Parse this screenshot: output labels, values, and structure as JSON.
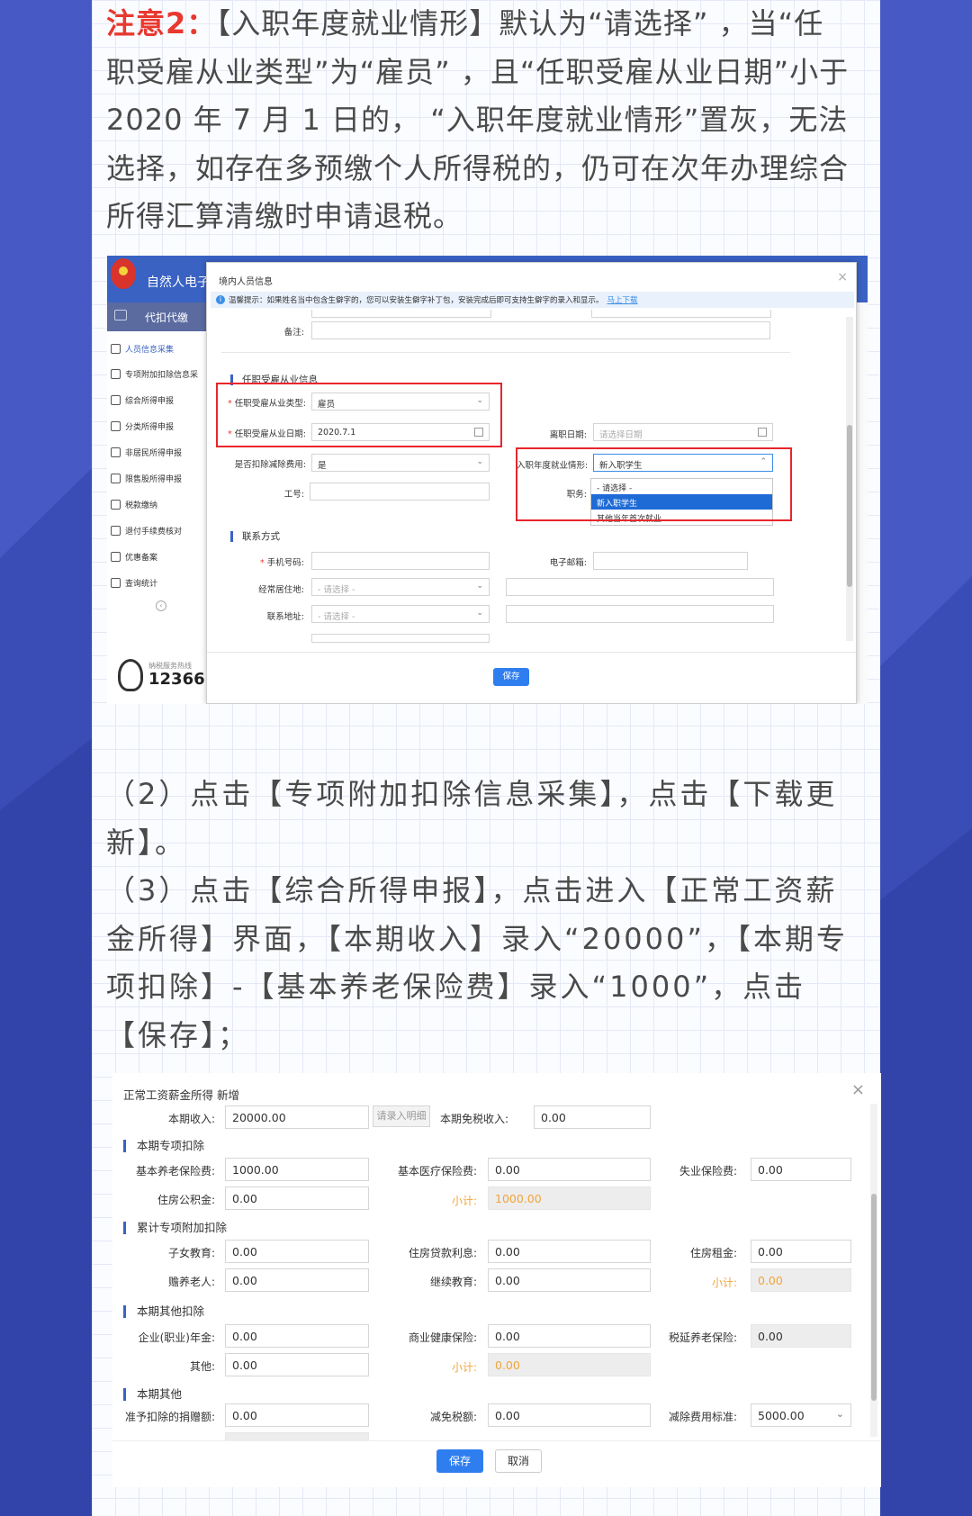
{
  "note2": {
    "prefix": "注意2：",
    "text": "【入职年度就业情形】默认为“请选择” ，当“任职受雇从业类型”为“雇员” ，且“任职受雇从业日期”小于 2020 年 7 月 1 日的， “入职年度就业情形”置灰，无法选择，如存在多预缴个人所得税的，仍可在次年办理综合所得汇算清缴时申请退税。"
  },
  "screenshot1": {
    "brand": "自然人电子",
    "sidebar": {
      "header": "代扣代缴",
      "items": [
        "人员信息采集",
        "专项附加扣除信息采",
        "综合所得申报",
        "分类所得申报",
        "非居民所得申报",
        "限售股所得申报",
        "税款缴纳",
        "退付手续费核对",
        "优惠备案",
        "查询统计"
      ],
      "collapse_glyph": "‹",
      "hotline_label": "纳税服务热线",
      "hotline": "12366"
    },
    "modal": {
      "title": "境内人员信息",
      "close": "×",
      "tip": "温馨提示：如果姓名当中包含生僻字的，您可以安装生僻字补丁包，安装完成后即可支持生僻字的录入和显示。",
      "tip_link": "马上下载",
      "remark_label": "备注:",
      "section_employment": "任职受雇从业信息",
      "type_label": "任职受雇从业类型:",
      "type_value": "雇员",
      "date_label": "任职受雇从业日期:",
      "date_value": "2020.7.1",
      "leave_label": "离职日期:",
      "leave_placeholder": "请选择日期",
      "deduct_label": "是否扣除减除费用:",
      "deduct_value": "是",
      "situation_label": "入职年度就业情形:",
      "situation_value": "新入职学生",
      "situation_options": [
        "- 请选择 -",
        "新入职学生",
        "其他当年首次就业"
      ],
      "jobno_label": "工号:",
      "position_label": "职务:",
      "section_contact": "联系方式",
      "phone_label": "手机号码:",
      "email_label": "电子邮箱:",
      "residence_label": "经常居住地:",
      "residence_placeholder": "- 请选择 -",
      "address_label": "联系地址:",
      "address_placeholder": "- 请选择 -",
      "save": "保存"
    }
  },
  "para2": {
    "step2": "（2）点击【专项附加扣除信息采集】，点击【下载更新】。",
    "step3": "（3）点击【综合所得申报】，点击进入【正常工资薪金所得】界面，【本期收入】录入“20000”，【本期专项扣除】-【基本养老保险费】录入“1000”，点击【保存】；"
  },
  "screenshot2": {
    "title": "正常工资薪金所得 新增",
    "close": "×",
    "income_label": "本期收入:",
    "income_value": "20000.00",
    "detail_button": "请录入明细",
    "taxfree_label": "本期免税收入:",
    "taxfree_value": "0.00",
    "section_special": "本期专项扣除",
    "pension_label": "基本养老保险费:",
    "pension_value": "1000.00",
    "medical_label": "基本医疗保险费:",
    "medical_value": "0.00",
    "unemployment_label": "失业保险费:",
    "unemployment_value": "0.00",
    "housingfund_label": "住房公积金:",
    "housingfund_value": "0.00",
    "subtotal_label": "小计:",
    "special_subtotal": "1000.00",
    "section_cumulative": "累计专项附加扣除",
    "children_label": "子女教育:",
    "children_value": "0.00",
    "loan_label": "住房贷款利息:",
    "loan_value": "0.00",
    "rent_label": "住房租金:",
    "rent_value": "0.00",
    "elderly_label": "赡养老人:",
    "elderly_value": "0.00",
    "continuing_label": "继续教育:",
    "continuing_value": "0.00",
    "cumulative_subtotal": "0.00",
    "section_other": "本期其他扣除",
    "annuity_label": "企业(职业)年金:",
    "annuity_value": "0.00",
    "health_label": "商业健康保险:",
    "health_value": "0.00",
    "deferred_label": "税延养老保险:",
    "deferred_value": "0.00",
    "other_label": "其他:",
    "other_value": "0.00",
    "other_subtotal": "0.00",
    "section_misc": "本期其他",
    "donation_label": "准予扣除的捐赠额:",
    "donation_value": "0.00",
    "relief_label": "减免税额:",
    "relief_value": "0.00",
    "standard_label": "减除费用标准:",
    "standard_value": "5000.00",
    "save": "保存",
    "cancel": "取消"
  },
  "colors": {
    "background": "#3a4db6",
    "accent_red": "#e8382f",
    "button_blue": "#2f7ef0",
    "subtotal_orange": "#f0a43a"
  }
}
